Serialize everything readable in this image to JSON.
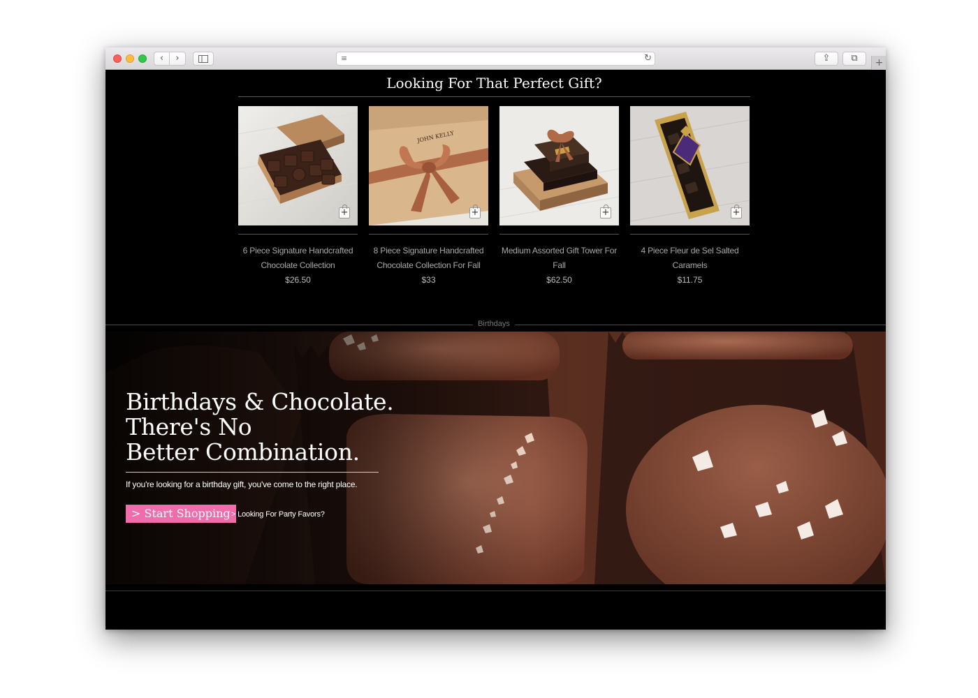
{
  "browser": {
    "back_glyph": "‹",
    "forward_glyph": "›",
    "reader_glyph": "≡",
    "reload_glyph": "↻",
    "share_glyph": "⇪",
    "tabs_glyph": "⧉",
    "new_tab_glyph": "+"
  },
  "gifts": {
    "title": "Looking For That Perfect Gift?",
    "products": [
      {
        "name_line1": "6 Piece Signature Handcrafted",
        "name_line2": "Chocolate Collection",
        "price": "$26.50",
        "icon": "chocolate-box-image"
      },
      {
        "name_line1": "8 Piece Signature Handcrafted",
        "name_line2": "Chocolate Collection For Fall",
        "price": "$33",
        "icon": "ribbon-box-image"
      },
      {
        "name_line1": "Medium Assorted Gift Tower For",
        "name_line2": "Fall",
        "price": "$62.50",
        "icon": "gift-tower-image"
      },
      {
        "name_line1": "4 Piece Fleur de Sel Salted",
        "name_line2": "Caramels",
        "price": "$11.75",
        "icon": "caramel-box-image"
      }
    ],
    "box_label": "JOHN KELLY"
  },
  "section": {
    "label": "Birthdays"
  },
  "hero": {
    "title_line1": "Birthdays & Chocolate.",
    "title_line2": "There's No",
    "title_line3": "Better Combination.",
    "subtitle": "If you're looking for a birthday gift, you've come to the right place.",
    "cta_primary": "> Start Shopping",
    "cta_secondary": "> Looking For Party Favors?"
  },
  "colors": {
    "page_bg": "#000000",
    "cta_pink": "#f06cab",
    "chocolate": "#7a3f2a"
  }
}
